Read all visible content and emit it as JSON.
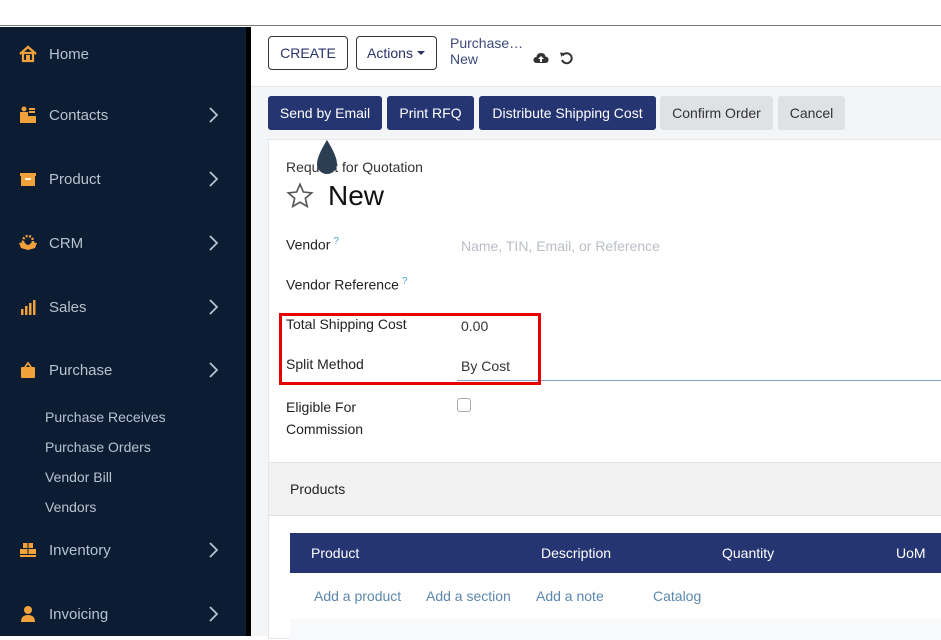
{
  "sidebar": {
    "items": [
      {
        "label": "Home",
        "icon": "home-icon",
        "has_chevron": false
      },
      {
        "label": "Contacts",
        "icon": "contacts-icon",
        "has_chevron": true
      },
      {
        "label": "Product",
        "icon": "product-box-icon",
        "has_chevron": true
      },
      {
        "label": "CRM",
        "icon": "handshake-icon",
        "has_chevron": true
      },
      {
        "label": "Sales",
        "icon": "bar-chart-icon",
        "has_chevron": true
      },
      {
        "label": "Purchase",
        "icon": "shopping-bag-icon",
        "has_chevron": true
      },
      {
        "label": "Inventory",
        "icon": "boxes-icon",
        "has_chevron": true
      },
      {
        "label": "Invoicing",
        "icon": "user-icon",
        "has_chevron": true
      }
    ],
    "purchase_submenu": [
      "Purchase Receives",
      "Purchase Orders",
      "Vendor Bill",
      "Vendors"
    ],
    "icon_color": "#f0a13a"
  },
  "control_panel": {
    "create_label": "CREATE",
    "actions_label": "Actions",
    "breadcrumb_parent": "Purchase…",
    "breadcrumb_current": "New",
    "save_icon": "cloud-upload-icon",
    "discard_icon": "undo-icon"
  },
  "statusbar": {
    "buttons": [
      {
        "label": "Send by Email",
        "style": "primary"
      },
      {
        "label": "Print RFQ",
        "style": "primary"
      },
      {
        "label": "Distribute Shipping Cost",
        "style": "primary"
      },
      {
        "label": "Confirm Order",
        "style": "secondary"
      },
      {
        "label": "Cancel",
        "style": "secondary"
      }
    ]
  },
  "form": {
    "doc_type": "Request for Quotation",
    "name": "New",
    "fields": {
      "vendor_label": "Vendor",
      "vendor_help": "?",
      "vendor_placeholder": "Name, TIN, Email, or Reference",
      "vendor_ref_label": "Vendor Reference",
      "vendor_ref_help": "?",
      "shipping_cost_label": "Total Shipping Cost",
      "shipping_cost_value": "0.00",
      "split_method_label": "Split Method",
      "split_method_value": "By Cost",
      "commission_label_1": "Eligible For",
      "commission_label_2": "Commission",
      "commission_checked": false
    }
  },
  "notebook": {
    "tab_label": "Products",
    "columns": [
      "Product",
      "Description",
      "Quantity",
      "UoM"
    ],
    "row_links": [
      "Add a product",
      "Add a section",
      "Add a note",
      "Catalog"
    ]
  },
  "colors": {
    "primary": "#253572",
    "sidebar_bg": "#0b1c33",
    "highlight": "#e60000"
  }
}
